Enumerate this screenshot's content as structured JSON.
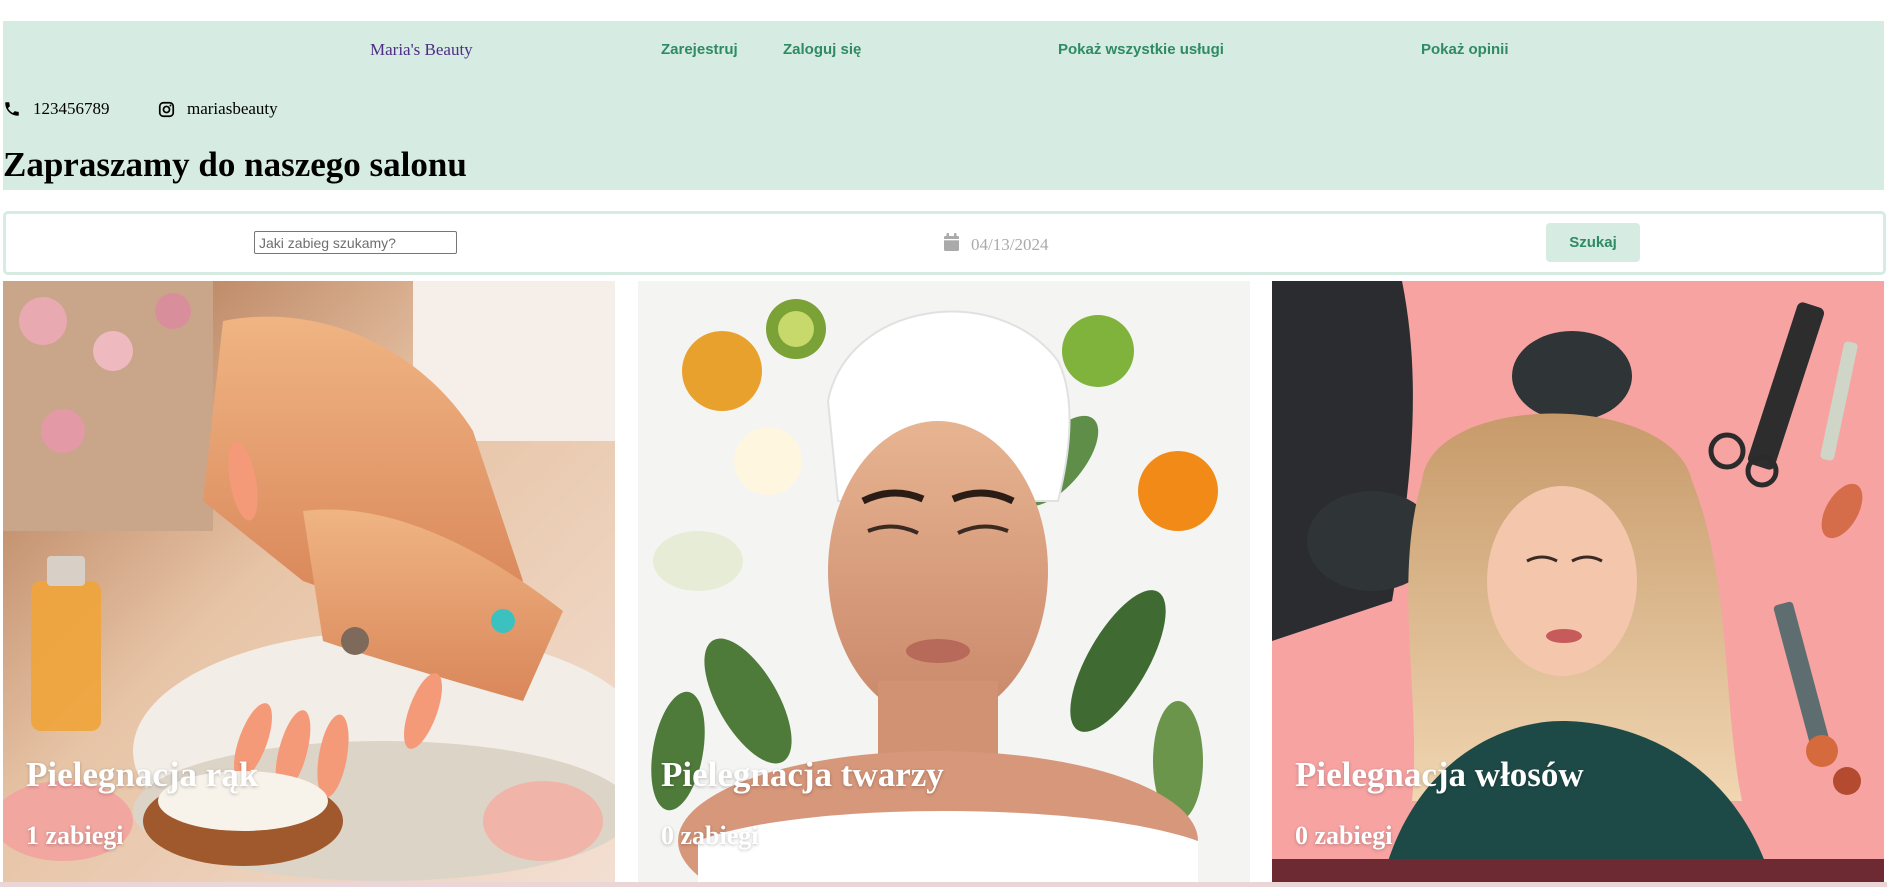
{
  "colors": {
    "header_bg": "#d6ebe2",
    "brand": "#4d2d86",
    "nav_link": "#2e8b63",
    "date_placeholder": "#aaaaaa",
    "card_text": "#ffffff"
  },
  "nav": {
    "brand": "Maria's Beauty",
    "register": "Zarejestruj",
    "login": "Zaloguj się",
    "all_services": "Pokaż wszystkie usługi",
    "reviews": "Pokaż opinii"
  },
  "contact": {
    "phone_icon": "phone-icon",
    "phone": "123456789",
    "instagram_icon": "instagram-icon",
    "instagram": "mariasbeauty"
  },
  "hero": {
    "title": "Zapraszamy do naszego salonu"
  },
  "search": {
    "placeholder": "Jaki zabieg szukamy?",
    "value": "",
    "calendar_icon": "calendar-icon",
    "date": "04/13/2024",
    "button": "Szukaj"
  },
  "categories": [
    {
      "title": "Pielegnacja rąk",
      "count": "1 zabiegi",
      "image": "hands-nails-illustration"
    },
    {
      "title": "Pielegnacja twarzy",
      "count": "0 zabiegi",
      "image": "face-care-illustration"
    },
    {
      "title": "Pielegnacja włosów",
      "count": "0 zabiegi",
      "image": "hair-care-illustration"
    }
  ]
}
